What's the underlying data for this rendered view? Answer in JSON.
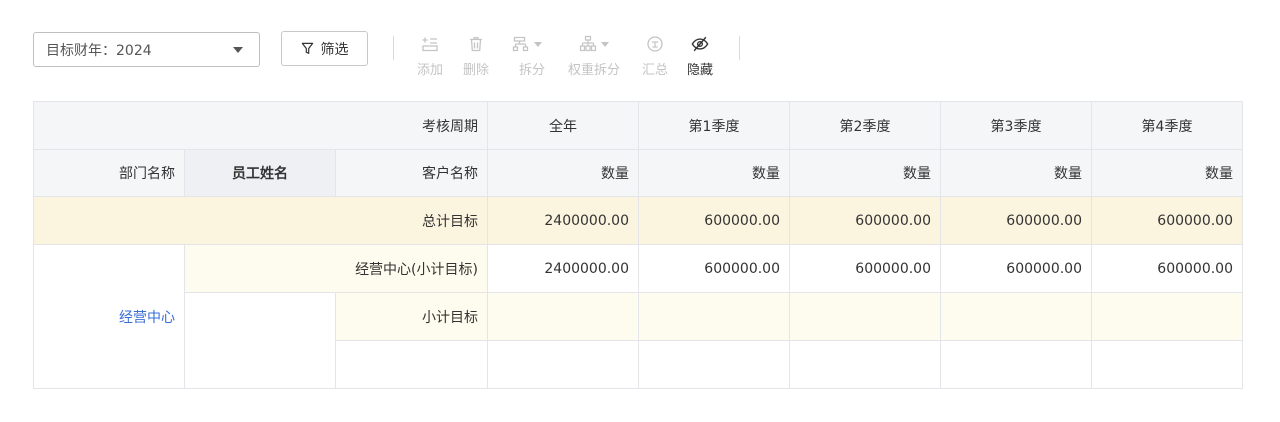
{
  "toolbar": {
    "year_select": "目标财年：2024",
    "filter_label": "筛选",
    "actions": [
      {
        "label": "添加",
        "icon": "add-row-icon"
      },
      {
        "label": "删除",
        "icon": "trash-icon"
      },
      {
        "label": "拆分",
        "icon": "split-icon"
      },
      {
        "label": "权重拆分",
        "icon": "weight-split-icon"
      },
      {
        "label": "汇总",
        "icon": "summary-icon"
      },
      {
        "label": "隐藏",
        "icon": "eye-off-icon"
      }
    ]
  },
  "table": {
    "period_header": "考核周期",
    "period_columns": [
      "全年",
      "第1季度",
      "第2季度",
      "第3季度",
      "第4季度"
    ],
    "dim_headers": [
      "部门名称",
      "员工姓名",
      "客户名称"
    ],
    "measure_label": "数量",
    "total_row": {
      "label": "总计目标",
      "values": [
        "2400000.00",
        "600000.00",
        "600000.00",
        "600000.00",
        "600000.00"
      ]
    },
    "department": "经营中心",
    "dept_subtotal": {
      "label": "经营中心(小计目标)",
      "values": [
        "2400000.00",
        "600000.00",
        "600000.00",
        "600000.00",
        "600000.00"
      ]
    },
    "subtotal_label": "小计目标"
  },
  "colors": {
    "header_bg": "#f5f6f8",
    "total_bg": "#fbf4df",
    "subtotal_bg": "#fdfcee",
    "link_blue": "#3a6fd8",
    "border": "#e3e5e8"
  }
}
